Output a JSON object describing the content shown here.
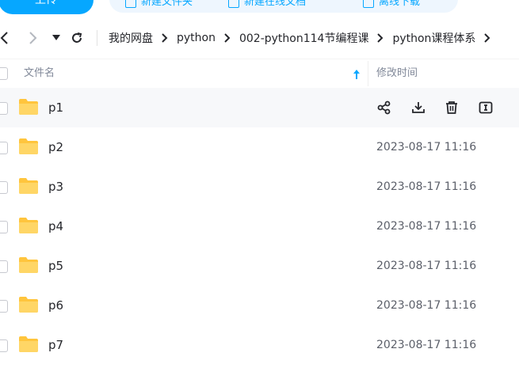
{
  "toolbar": {
    "upload_label": "上传",
    "new_folder_label": "新建文件夹",
    "new_online_doc_label": "新建在线文档",
    "offline_download_label": "离线下载"
  },
  "breadcrumb": {
    "items": [
      "我的网盘",
      "python",
      "002-python114节编程课",
      "python课程体系"
    ]
  },
  "table": {
    "col_name": "文件名",
    "col_time": "修改时间",
    "rows": [
      {
        "name": "p1",
        "time": ""
      },
      {
        "name": "p2",
        "time": "2023-08-17 11:16"
      },
      {
        "name": "p3",
        "time": "2023-08-17 11:16"
      },
      {
        "name": "p4",
        "time": "2023-08-17 11:16"
      },
      {
        "name": "p5",
        "time": "2023-08-17 11:16"
      },
      {
        "name": "p6",
        "time": "2023-08-17 11:16"
      },
      {
        "name": "p7",
        "time": "2023-08-17 11:16"
      }
    ],
    "hover_row_actions": [
      "share-icon",
      "download-icon",
      "trash-icon",
      "rename-icon"
    ]
  },
  "colors": {
    "accent": "#06a7ff",
    "folder": "#ffc53d",
    "hover_row": "#f7f8fa"
  }
}
